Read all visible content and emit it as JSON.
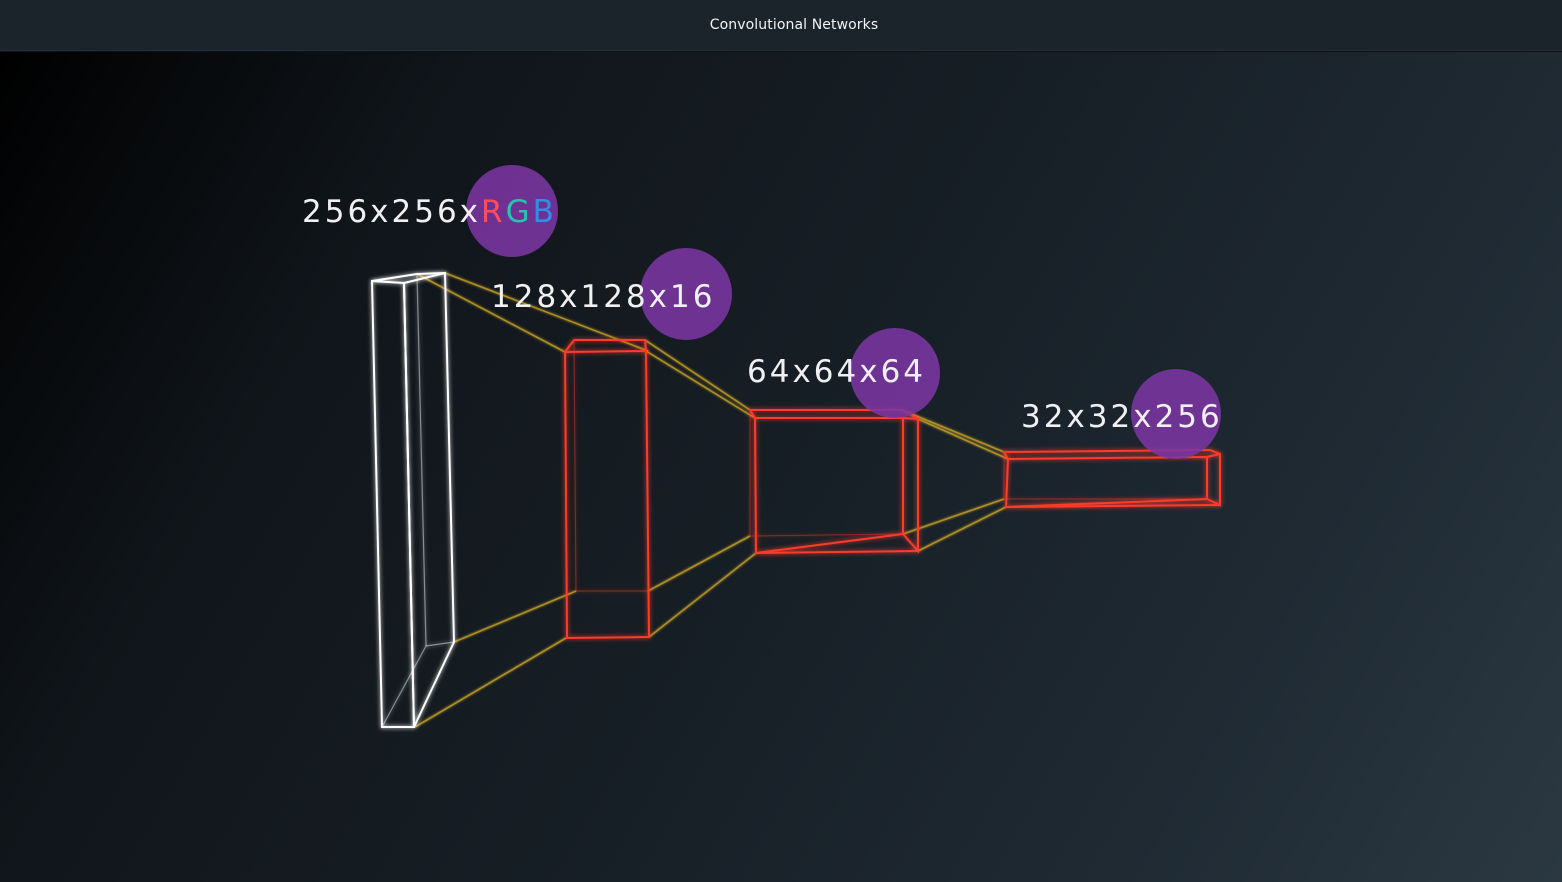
{
  "window": {
    "title": "Convolutional Networks"
  },
  "diagram": {
    "layers": [
      {
        "dims_prefix": "256x256x",
        "channels": {
          "r": "R",
          "g": "G",
          "b": "B"
        }
      },
      {
        "dims": "128x128x16"
      },
      {
        "dims": "64x64x64"
      },
      {
        "dims": "32x32x256"
      }
    ],
    "colors": {
      "input_box": "#ffffff",
      "conv_box": "#ff3a2a",
      "connector": "#c9a227",
      "highlight_circle": "#7b35a3",
      "channel_r": "#ff4d5c",
      "channel_g": "#27c4b0",
      "channel_b": "#2f8ee8"
    }
  }
}
